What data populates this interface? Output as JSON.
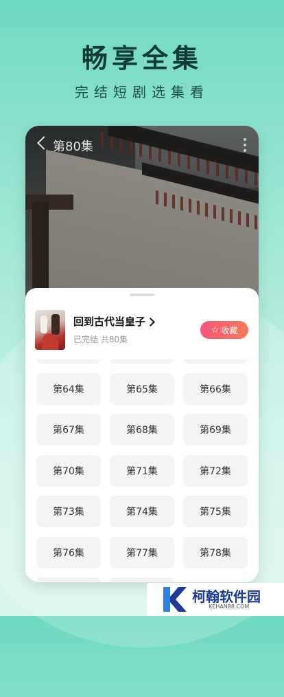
{
  "promo": {
    "headline": "畅享全集",
    "subline": "完结短剧选集看"
  },
  "player": {
    "episode_title": "第80集"
  },
  "drama": {
    "title": "回到古代当皇子",
    "meta": "已完结 共80集",
    "favorite_label": "收藏",
    "favorite_icon": "star-outline-icon"
  },
  "episodes": [
    "",
    "",
    "",
    "第64集",
    "第65集",
    "第66集",
    "第67集",
    "第68集",
    "第69集",
    "第70集",
    "第71集",
    "第72集",
    "第73集",
    "第74集",
    "第75集",
    "第76集",
    "第77集",
    "第78集",
    "",
    ""
  ],
  "watermark": {
    "name": "柯翰软件园",
    "url": "KEHAN88.COM"
  },
  "colors": {
    "accent_gradient_start": "#f4577a",
    "accent_gradient_end": "#f77a56",
    "brand_blue": "#1d3c9a",
    "background_mint": "#6fd9c2"
  }
}
